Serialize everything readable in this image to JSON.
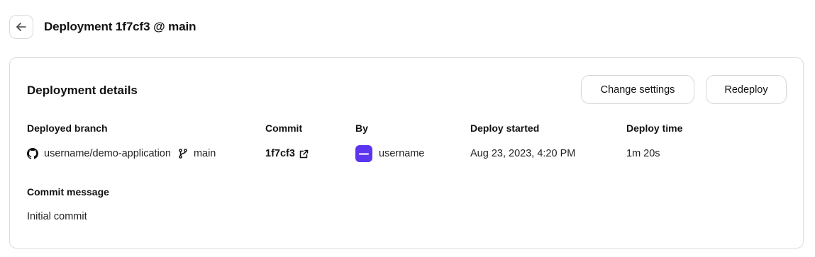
{
  "header": {
    "back_icon": "arrow-left-icon",
    "title": "Deployment 1f7cf3 @ main"
  },
  "card": {
    "title": "Deployment details",
    "buttons": {
      "change_settings": "Change settings",
      "redeploy": "Redeploy"
    },
    "columns": {
      "branch": {
        "label": "Deployed branch",
        "repo_icon": "github-icon",
        "repo": "username/demo-application",
        "branch_icon": "git-branch-icon",
        "branch": "main"
      },
      "commit": {
        "label": "Commit",
        "hash": "1f7cf3",
        "link_icon": "external-link-icon"
      },
      "by": {
        "label": "By",
        "avatar_color": "#5b35f0",
        "username": "username"
      },
      "started": {
        "label": "Deploy started",
        "value": "Aug 23, 2023, 4:20 PM"
      },
      "time": {
        "label": "Deploy time",
        "value": "1m 20s"
      }
    },
    "commit_message": {
      "label": "Commit message",
      "value": "Initial commit"
    }
  }
}
